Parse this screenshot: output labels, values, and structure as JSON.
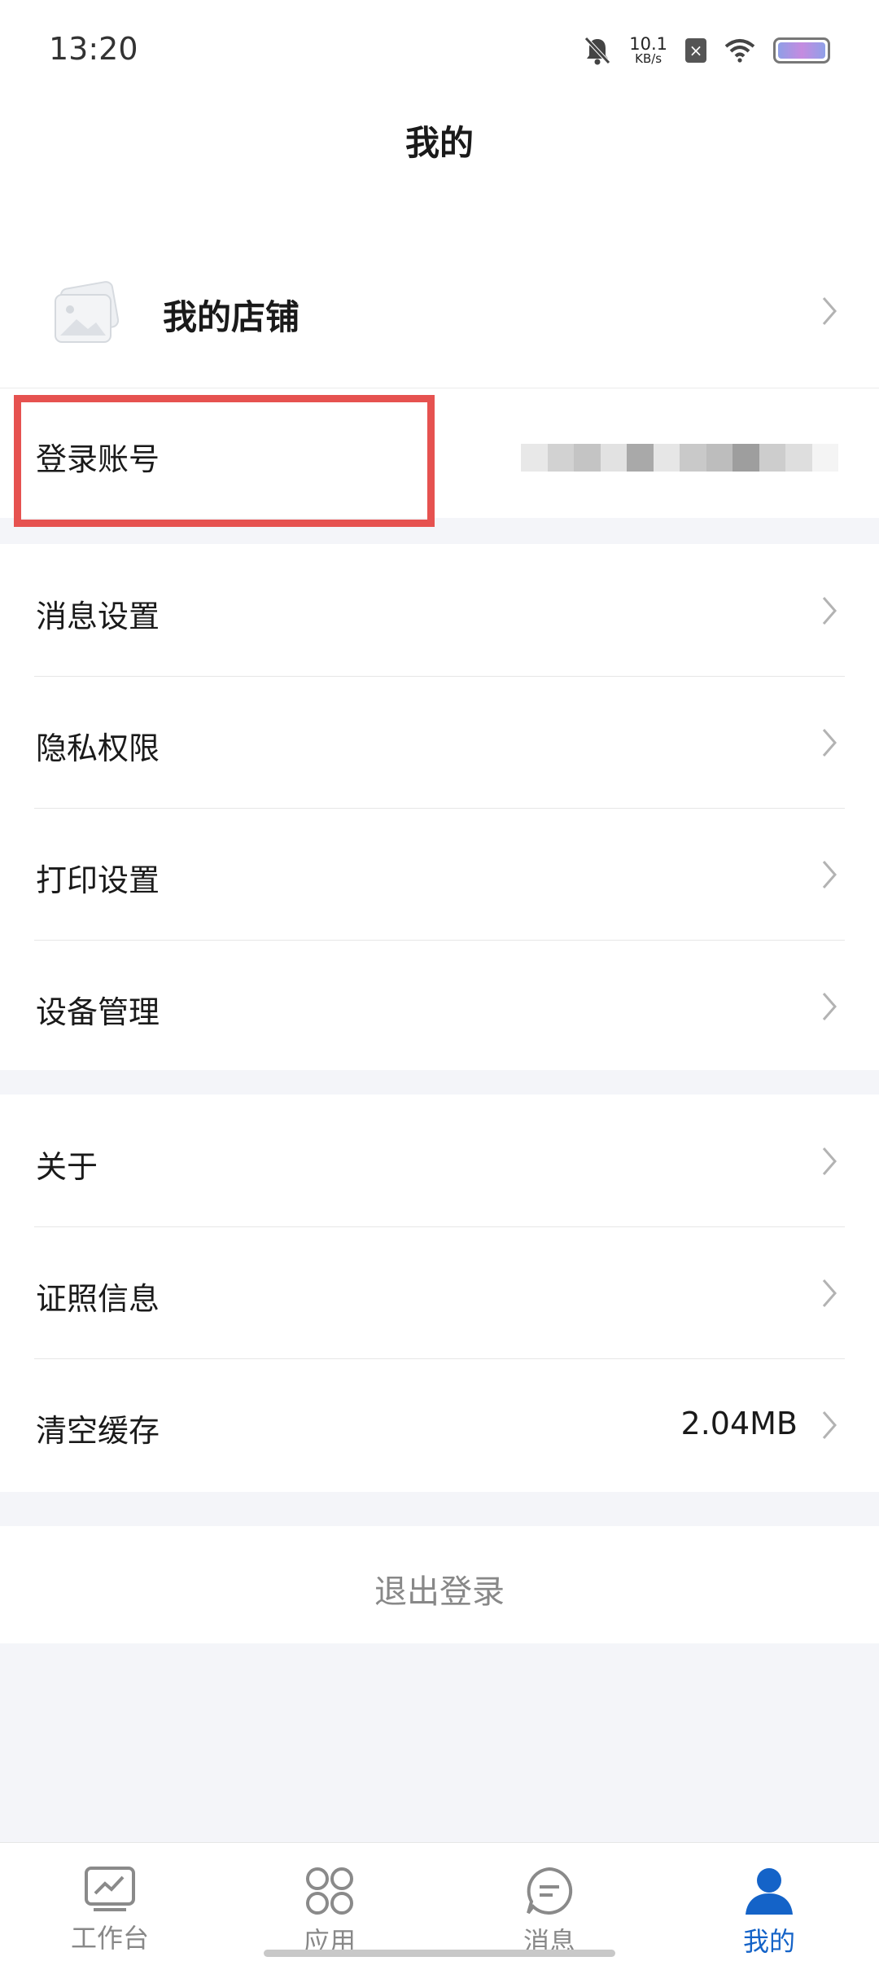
{
  "status_bar": {
    "time": "13:20",
    "net_speed_value": "10.1",
    "net_speed_unit": "KB/s",
    "icons": [
      "bell-muted-icon",
      "sim-off-icon",
      "wifi-icon",
      "battery-icon"
    ]
  },
  "header": {
    "title": "我的"
  },
  "store": {
    "label": "我的店铺",
    "icon": "store-image-icon"
  },
  "account": {
    "label": "登录账号",
    "value_obscured": true,
    "highlight_color": "#e65250"
  },
  "settings_group_1": {
    "items": [
      {
        "label": "消息设置"
      },
      {
        "label": "隐私权限"
      },
      {
        "label": "打印设置"
      },
      {
        "label": "设备管理"
      }
    ]
  },
  "settings_group_2": {
    "items": [
      {
        "label": "关于",
        "value": ""
      },
      {
        "label": "证照信息",
        "value": ""
      },
      {
        "label": "清空缓存",
        "value": "2.04MB"
      }
    ]
  },
  "logout": {
    "label": "退出登录"
  },
  "tab_bar": {
    "active_color": "#1463c8",
    "tabs": [
      {
        "label": "工作台",
        "icon": "workbench-chart-icon",
        "active": false
      },
      {
        "label": "应用",
        "icon": "apps-grid-icon",
        "active": false
      },
      {
        "label": "消息",
        "icon": "message-bubble-icon",
        "active": false
      },
      {
        "label": "我的",
        "icon": "person-icon",
        "active": true
      }
    ]
  }
}
